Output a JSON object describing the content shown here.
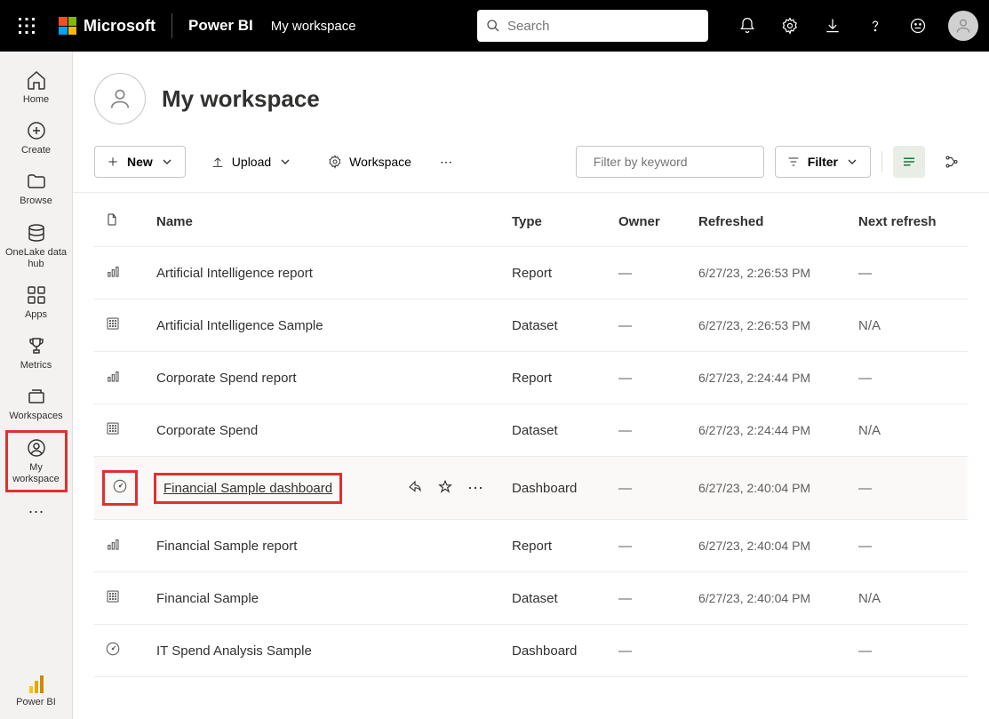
{
  "brand": {
    "microsoft": "Microsoft",
    "product": "Power BI",
    "context": "My workspace"
  },
  "search": {
    "placeholder": "Search"
  },
  "leftnav": {
    "home": "Home",
    "create": "Create",
    "browse": "Browse",
    "onelake": "OneLake data hub",
    "apps": "Apps",
    "metrics": "Metrics",
    "workspaces": "Workspaces",
    "myworkspace": "My workspace",
    "powerbi": "Power BI"
  },
  "workspace": {
    "title": "My workspace"
  },
  "toolbar": {
    "new": "New",
    "upload": "Upload",
    "workspace": "Workspace",
    "filter_placeholder": "Filter by keyword",
    "filter": "Filter"
  },
  "table": {
    "headers": {
      "name": "Name",
      "type": "Type",
      "owner": "Owner",
      "refreshed": "Refreshed",
      "next": "Next refresh"
    },
    "rows": [
      {
        "name": "Artificial Intelligence report",
        "type": "Report",
        "owner": "—",
        "refreshed": "6/27/23, 2:26:53 PM",
        "next": "—",
        "icon": "report"
      },
      {
        "name": "Artificial Intelligence Sample",
        "type": "Dataset",
        "owner": "—",
        "refreshed": "6/27/23, 2:26:53 PM",
        "next": "N/A",
        "icon": "dataset"
      },
      {
        "name": "Corporate Spend report",
        "type": "Report",
        "owner": "—",
        "refreshed": "6/27/23, 2:24:44 PM",
        "next": "—",
        "icon": "report"
      },
      {
        "name": "Corporate Spend",
        "type": "Dataset",
        "owner": "—",
        "refreshed": "6/27/23, 2:24:44 PM",
        "next": "N/A",
        "icon": "dataset"
      },
      {
        "name": "Financial Sample dashboard",
        "type": "Dashboard",
        "owner": "—",
        "refreshed": "6/27/23, 2:40:04 PM",
        "next": "—",
        "icon": "dashboard",
        "highlighted": true
      },
      {
        "name": "Financial Sample report",
        "type": "Report",
        "owner": "—",
        "refreshed": "6/27/23, 2:40:04 PM",
        "next": "—",
        "icon": "report"
      },
      {
        "name": "Financial Sample",
        "type": "Dataset",
        "owner": "—",
        "refreshed": "6/27/23, 2:40:04 PM",
        "next": "N/A",
        "icon": "dataset"
      },
      {
        "name": "IT Spend Analysis Sample",
        "type": "Dashboard",
        "owner": "—",
        "refreshed": "",
        "next": "—",
        "icon": "dashboard"
      }
    ]
  }
}
